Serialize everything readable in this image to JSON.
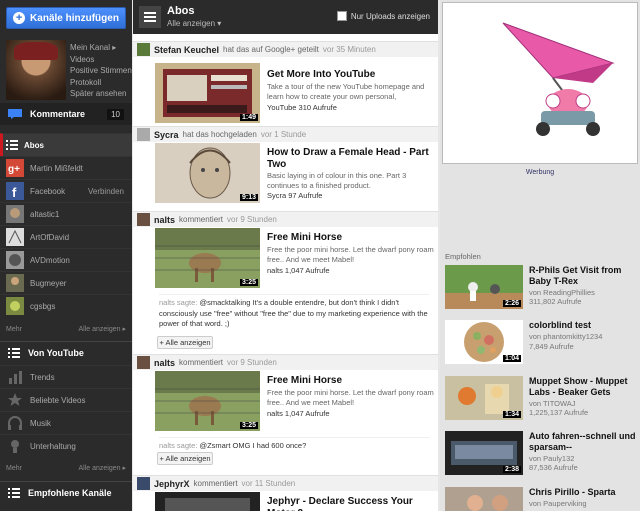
{
  "sidebar": {
    "add_channels": "Kanäle hinzufügen",
    "profile_links": [
      "Mein Kanal ▸",
      "Videos",
      "Positive Stimmen",
      "Protokoll",
      "Später ansehen"
    ],
    "comments_label": "Kommentare",
    "comments_count": "10",
    "abos_label": "Abos",
    "subscriptions": [
      {
        "name": "Martin Mißfeldt",
        "icon": "google-plus-icon",
        "right": ""
      },
      {
        "name": "Facebook",
        "icon": "facebook-icon",
        "right": "Verbinden"
      },
      {
        "name": "altastic1",
        "icon": "channel-avatar",
        "right": ""
      },
      {
        "name": "ArtOfDavid",
        "icon": "channel-avatar",
        "right": ""
      },
      {
        "name": "AVDmotion",
        "icon": "channel-avatar",
        "right": ""
      },
      {
        "name": "Bugmeyer",
        "icon": "channel-avatar",
        "right": ""
      },
      {
        "name": "cgsbgs",
        "icon": "channel-avatar",
        "right": ""
      }
    ],
    "more_label": "Mehr",
    "show_all_label": "Alle anzeigen ▸",
    "from_youtube_label": "Von YouTube",
    "youtube_items": [
      {
        "name": "Trends",
        "icon": "trends-icon"
      },
      {
        "name": "Beliebte Videos",
        "icon": "star-icon"
      },
      {
        "name": "Musik",
        "icon": "headphones-icon"
      },
      {
        "name": "Unterhaltung",
        "icon": "entertainment-icon"
      }
    ],
    "recommended_channels_label": "Empfohlene Kanäle"
  },
  "header": {
    "title": "Abos",
    "subtitle": "Alle anzeigen ▾",
    "only_uploads": "Nur Uploads anzeigen"
  },
  "feed": [
    {
      "user": "Stefan Keuchel",
      "action": "hat das auf Google+ geteilt",
      "time": "vor 35 Minuten",
      "title": "Get More Into YouTube",
      "desc": "Take a tour of the new YouTube homepage and learn how to create your own personal,",
      "meta": "YouTube 310 Aufrufe",
      "duration": "1:49"
    },
    {
      "user": "Sycra",
      "action": "hat das hochgeladen",
      "time": "vor 1 Stunde",
      "title": "How to Draw a Female Head - Part Two",
      "desc": "Basic laying in of colour in this one. Part 3 continues to a finished product.",
      "meta": "Sycra 97 Aufrufe",
      "duration": "9:13"
    },
    {
      "user": "nalts",
      "action": "kommentiert",
      "time": "vor 9 Stunden",
      "title": "Free Mini Horse",
      "desc": "Free the poor mini horse. Let the dwarf pony roam free.. And we meet Mabel!",
      "meta": "nalts 1,047 Aufrufe",
      "duration": "3:25",
      "comment_who": "nalts sagte:",
      "comment": "@smacktalking It's a double entendre, but don't think I didn't consciously use \"free\" without \"free the\" due to my marketing experience with the power of that word. ;)",
      "button": "+ Alle anzeigen"
    },
    {
      "user": "nalts",
      "action": "kommentiert",
      "time": "vor 9 Stunden",
      "title": "Free Mini Horse",
      "desc": "Free the poor mini horse. Let the dwarf pony roam free.. And we meet Mabel!",
      "meta": "nalts 1,047 Aufrufe",
      "duration": "3:25",
      "comment_who": "nalts sagte:",
      "comment": "@Zsmart OMG I had 600 once?",
      "button": "+ Alle anzeigen"
    },
    {
      "user": "JephyrX",
      "action": "kommentiert",
      "time": "vor 11 Stunden",
      "title": "Jephyr - Declare Success Your Motor 2"
    }
  ],
  "right": {
    "ad_label": "Werbung",
    "recommended_label": "Empfohlen",
    "recommended": [
      {
        "title": "R-Phils Get Visit from Baby T-Rex",
        "by": "von ReadingPhillies",
        "views": "311,802 Aufrufe",
        "duration": "2:26"
      },
      {
        "title": "colorblind test",
        "by": "von phantomkitty1234",
        "views": "7,849 Aufrufe",
        "duration": "1:04"
      },
      {
        "title": "Muppet Show - Muppet Labs - Beaker Gets",
        "by": "von TITOWAJ",
        "views": "1,225,137 Aufrufe",
        "duration": "1:34"
      },
      {
        "title": "Auto fahren--schnell und sparsam--",
        "by": "von Pauly132",
        "views": "87,536 Aufrufe",
        "duration": "2:38"
      },
      {
        "title": "Chris Pirillo - Sparta",
        "by": "von Pauperviking",
        "views": "",
        "duration": ""
      }
    ]
  },
  "colors": {
    "sidebar_bg": "#2b2b2b",
    "accent_blue": "#2f6fd6",
    "active_red": "#cc181e"
  }
}
